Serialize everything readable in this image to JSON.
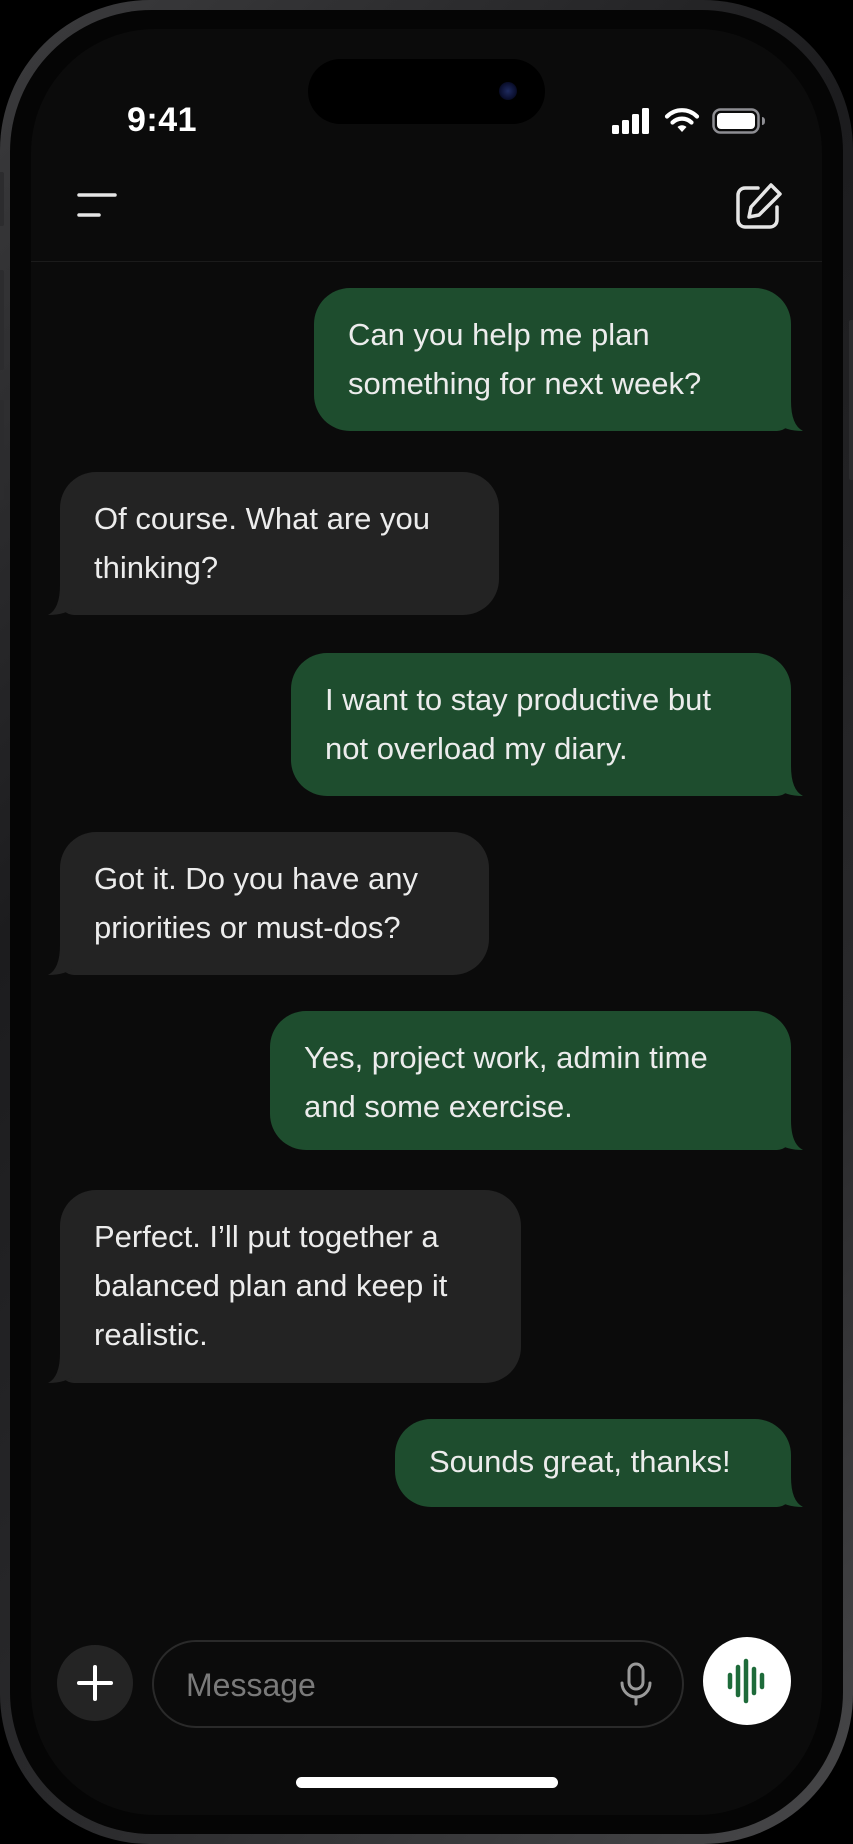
{
  "status_bar": {
    "time": "9:41",
    "icons": [
      "cellular-signal-icon",
      "wifi-icon",
      "battery-icon"
    ]
  },
  "header": {
    "menu_icon": "hamburger-menu-icon",
    "compose_icon": "new-chat-compose-icon"
  },
  "messages": [
    {
      "role": "user",
      "text": "Can you help me plan something for next week?"
    },
    {
      "role": "assistant",
      "text": "Of course. What are you thinking?"
    },
    {
      "role": "user",
      "text": "I want to stay productive but not overload my diary."
    },
    {
      "role": "assistant",
      "text": "Got it. Do you have any priorities or must-dos?"
    },
    {
      "role": "user",
      "text": "Yes, project work, admin time and some exercise."
    },
    {
      "role": "assistant",
      "text": "Perfect. I’ll put together a balanced plan and keep it realistic."
    },
    {
      "role": "user",
      "text": "Sounds great, thanks!"
    }
  ],
  "composer": {
    "placeholder": "Message",
    "value": "",
    "attach_icon": "plus-icon",
    "mic_icon": "microphone-icon",
    "voice_icon": "voice-waveform-icon"
  },
  "colors": {
    "user_bubble": "#1e4d2e",
    "assistant_bubble": "#232323",
    "background": "#0b0b0b",
    "accent_green": "#1e6b3a",
    "text": "#ececec"
  }
}
